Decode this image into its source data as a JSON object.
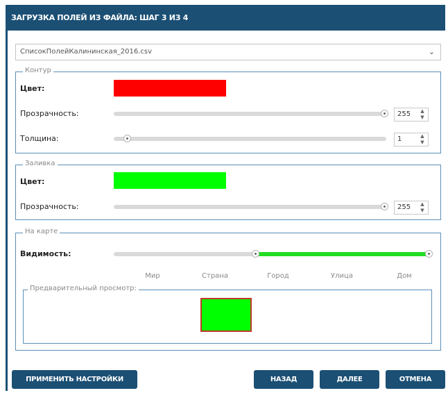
{
  "dialog": {
    "title": "ЗАГРУЗКА ПОЛЕЙ ИЗ ФАЙЛА: ШАГ 3 ИЗ 4",
    "file": "СписокПолейКалининская_2016.csv",
    "file_icon": "chevron-down-icon"
  },
  "outline": {
    "legend": "Контур",
    "color_label": "Цвет:",
    "color": "#ff0000",
    "opacity_label": "Прозрачность:",
    "opacity_value": "255",
    "opacity_fraction": 1.0,
    "thickness_label": "Толщина:",
    "thickness_value": "1",
    "thickness_fraction": 0.04
  },
  "fill": {
    "legend": "Заливка",
    "color_label": "Цвет:",
    "color": "#00ff00",
    "opacity_label": "Прозрачность:",
    "opacity_value": "255",
    "opacity_fraction": 1.0
  },
  "map": {
    "legend": "На карте",
    "visibility_label": "Видимость:",
    "range_start_fraction": 0.5,
    "range_end_fraction": 1.0,
    "range_color": "#22dd22",
    "ticks": [
      "Мир",
      "Страна",
      "Город",
      "Улица",
      "Дом"
    ],
    "preview_legend": "Предварительный просмотр:",
    "preview_fill": "#00ff00",
    "preview_stroke": "#c0392b"
  },
  "footer": {
    "apply": "ПРИМЕНИТЬ НАСТРОЙКИ",
    "back": "НАЗАД",
    "next": "ДАЛЕЕ",
    "cancel": "ОТМЕНА",
    "button_color": "#1b4f74"
  }
}
